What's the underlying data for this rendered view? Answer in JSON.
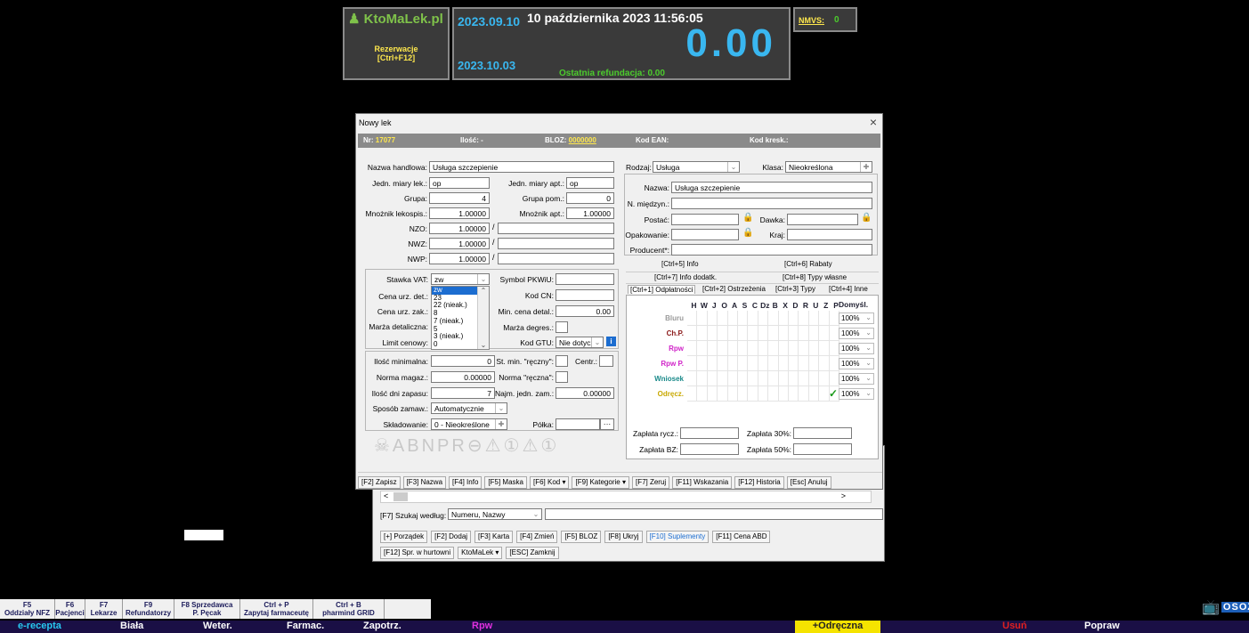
{
  "top": {
    "logo": "KtoMaLek.pl",
    "reservations_line1": "Rezerwacje",
    "reservations_line2": "[Ctrl+F12]",
    "date_short": "2023.09.10",
    "date_long": "10 października 2023  11:56:05",
    "amount": "0.00",
    "date_second": "2023.10.03",
    "last_refund_label": "Ostatnia refundacja: 0.00",
    "nmvs_label": "NMVS:",
    "nmvs_value": "0"
  },
  "dialog": {
    "title": "Nowy lek",
    "close": "×",
    "header": {
      "nr_label": "Nr:",
      "nr_value": "17077",
      "ilosc_label": "Ilość:",
      "ilosc_value": "-",
      "bloz_label": "BLOZ:",
      "bloz_value": "0000000",
      "ean_label": "Kod EAN:",
      "kresk_label": "Kod kresk.:"
    },
    "left": {
      "nazwa_handlowa_label": "Nazwa handlowa:",
      "nazwa_handlowa": "Usługa szczepienie",
      "jedn_lek_label": "Jedn. miary lek.:",
      "jedn_lek": "op",
      "jedn_apt_label": "Jedn. miary apt.:",
      "jedn_apt": "op",
      "grupa_label": "Grupa:",
      "grupa": "4",
      "grupa_pom_label": "Grupa pom.:",
      "grupa_pom": "0",
      "mnoznik_lek_label": "Mnożnik lekospis.:",
      "mnoznik_lek": "1.00000",
      "mnoznik_apt_label": "Mnożnik apt.:",
      "mnoznik_apt": "1.00000",
      "nzo_label": "NZO:",
      "nzo": "1.00000",
      "nwz_label": "NWZ:",
      "nwz": "1.00000",
      "nwp_label": "NWP:",
      "nwp": "1.00000",
      "slash": "/",
      "stawka_vat_label": "Stawka VAT:",
      "stawka_vat": "zw",
      "vat_options": [
        "zw",
        "23",
        "22 (nieak.)",
        "8",
        "7 (nieak.)",
        "5",
        "3 (nieak.)",
        "0"
      ],
      "cena_det_label": "Cena urz. det.:",
      "cena_zak_label": "Cena urz. zak.:",
      "marza_det_label": "Marża detaliczna:",
      "limit_label": "Limit cenowy:",
      "pkwiu_label": "Symbol PKWiU:",
      "kodcn_label": "Kod CN:",
      "min_cena_label": "Min. cena detal.:",
      "min_cena": "0.00",
      "marza_degres_label": "Marża degres.:",
      "gtu_label": "Kod GTU:",
      "gtu": "Nie dotyczy",
      "ilosc_min_label": "Ilość minimalna:",
      "ilosc_min": "0",
      "st_min_label": "St. min. \"ręczny\":",
      "centr_label": "Centr.:",
      "norma_magaz_label": "Norma magaz.:",
      "norma_magaz": "0.00000",
      "norma_reczna_label": "Norma \"ręczna\":",
      "ilosc_dni_label": "Ilość dni zapasu:",
      "ilosc_dni": "7",
      "najm_jedn_label": "Najm. jedn. zam.:",
      "najm_jedn": "0.00000",
      "sposob_label": "Sposób zamaw.:",
      "sposob": "Automatycznie",
      "skladowanie_label": "Składowanie:",
      "skladowanie": "0 - Nieokreślone",
      "polka_label": "Półka:",
      "polka_btn": "···",
      "symbols": "☠ABNPR⊖⚠①⚠①"
    },
    "right": {
      "rodzaj_label": "Rodzaj:",
      "rodzaj": "Usługa",
      "klasa_label": "Klasa:",
      "klasa": "Nieokreślona",
      "nazwa_label": "Nazwa:",
      "nazwa": "Usługa szczepienie",
      "miedzyn_label": "N. międzyn.:",
      "postac_label": "Postać:",
      "dawka_label": "Dawka:",
      "opakowanie_label": "Opakowanie:",
      "kraj_label": "Kraj:",
      "producent_label": "Producent*:",
      "tabs_row1": [
        "[Ctrl+5] Info",
        "[Ctrl+6] Rabaty"
      ],
      "tabs_row2": [
        "[Ctrl+7] Info dodatk.",
        "[Ctrl+8] Typy własne"
      ],
      "tabs_row3": [
        "[Ctrl+1] Odpłatności",
        "[Ctrl+2] Ostrzeżenia",
        "[Ctrl+3] Typy",
        "[Ctrl+4] Inne"
      ],
      "grid_headers": [
        "H",
        "W",
        "J",
        "O",
        "A",
        "S",
        "C",
        "Dz",
        "B",
        "X",
        "D",
        "R",
        "U",
        "Z",
        "P"
      ],
      "domysl_label": "Domyśl.",
      "rows": [
        {
          "label": "Bluru",
          "color": "#9a9a9a",
          "value": "100%",
          "check": ""
        },
        {
          "label": "Ch.P.",
          "color": "#8b1a1a",
          "value": "100%",
          "check": ""
        },
        {
          "label": "Rpw",
          "color": "#d022c8",
          "value": "100%",
          "check": ""
        },
        {
          "label": "Rpw P.",
          "color": "#d022c8",
          "value": "100%",
          "check": ""
        },
        {
          "label": "Wniosek",
          "color": "#1a8a8a",
          "value": "100%",
          "check": ""
        },
        {
          "label": "Odręcz.",
          "color": "#c8a800",
          "value": "100%",
          "check": "✓"
        }
      ],
      "zaplata_rycz_label": "Zapłata rycz.:",
      "zaplata30_label": "Zapłata 30%:",
      "zaplata_bz_label": "Zapłata BZ:",
      "zaplata50_label": "Zapłata 50%:"
    },
    "buttons": [
      "[F2] Zapisz",
      "[F3] Nazwa",
      "[F4] Info",
      "[F5] Maska",
      "[F6] Kod ▾",
      "[F9] Kategorie ▾",
      "[F7] Zeruj",
      "[F11] Wskazania",
      "[F12] Historia",
      "[Esc] Anuluj"
    ]
  },
  "back": {
    "scroll_left": "<",
    "scroll_right": ">",
    "search_label": "[F7] Szukaj według:",
    "search_by": "Numeru, Nazwy",
    "buttons_row1": [
      "[+] Porządek",
      "[F2] Dodaj",
      "[F3] Karta",
      "[F4] Zmień",
      "[F5] BLOZ",
      "[F8] Ukryj",
      "[F10] Suplementy",
      "[F11] Cena ABD"
    ],
    "buttons_row2": [
      "[F12] Spr. w hurtowni",
      "KtoMaLek ▾",
      "[ESC] Zamknij"
    ]
  },
  "fkeys": [
    {
      "key": "F5",
      "label": "Oddziały NFZ"
    },
    {
      "key": "F6",
      "label": "Pacjenci"
    },
    {
      "key": "F7",
      "label": "Lekarze"
    },
    {
      "key": "F9",
      "label": "Refundatorzy"
    },
    {
      "key": "F8 Sprzedawca",
      "label": "P. Pęcak"
    },
    {
      "key": "Ctrl + P",
      "label": "Zapytaj farmaceutę"
    },
    {
      "key": "Ctrl + B",
      "label": "pharmind GRID"
    }
  ],
  "osoz": "OSOZ",
  "bottom": {
    "erecepta": "e-recepta",
    "biala": "Biała",
    "weter": "Weter.",
    "farmac": "Farmac.",
    "zapotrz": "Zapotrz.",
    "rpw": "Rpw",
    "odreczna": "+Odręczna",
    "usun": "Usuń",
    "popraw": "Popraw"
  }
}
